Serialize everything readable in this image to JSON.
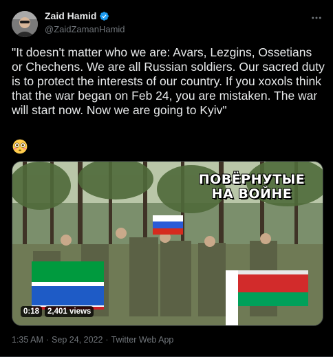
{
  "author": {
    "display_name": "Zaid Hamid",
    "handle": "@ZaidZamanHamid"
  },
  "tweet": {
    "text": "\"It doesn't matter who we are: Avars, Lezgins, Ossetians or Chechens. We are all Russian soldiers. Our sacred duty is to protect the interests of our country. If you xoxols think that the war began on Feb 24, you are mistaken. The war will start now. Now we are going to Kyiv\"",
    "emoji": "😳"
  },
  "media": {
    "overlay_caption": "ПОВЁРНУТЫЕ\nНА ВОЙНЕ",
    "duration": "0:18",
    "views": "2,401 views"
  },
  "meta": {
    "time": "1:35 AM",
    "separator": "·",
    "date": "Sep 24, 2022",
    "source": "Twitter Web App"
  },
  "colors": {
    "background": "#000000",
    "text": "#e7e9ea",
    "secondary_text": "#71767b",
    "verified": "#1d9bf0"
  },
  "icons": [
    "avatar-icon",
    "verified-badge-icon",
    "more-options-icon",
    "flushed-face-emoji"
  ]
}
